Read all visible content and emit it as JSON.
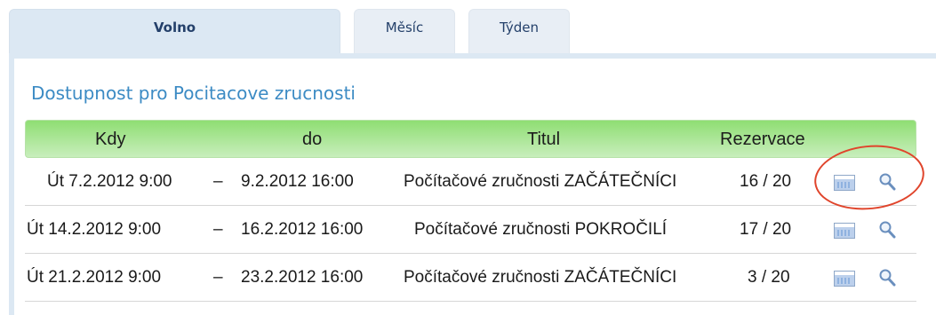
{
  "tabs": [
    {
      "label": "Volno",
      "active": true
    },
    {
      "label": "Měsíc",
      "active": false
    },
    {
      "label": "Týden",
      "active": false
    }
  ],
  "availability_title": "Dostupnost pro Pocitacove zrucnosti",
  "table": {
    "headers": {
      "when": "Kdy",
      "to": "do",
      "title": "Titul",
      "reservations": "Rezervace"
    },
    "rows": [
      {
        "from": "Út 7.2.2012 9:00",
        "dash": "–",
        "to": "9.2.2012 16:00",
        "title": "Počítačové zručnosti ZAČÁTEČNÍCI",
        "reservations": "16 / 20"
      },
      {
        "from": "Út 14.2.2012 9:00",
        "dash": "–",
        "to": "16.2.2012 16:00",
        "title": "Počítačové zručnosti POKROČILÍ",
        "reservations": "17 / 20"
      },
      {
        "from": "Út 21.2.2012 9:00",
        "dash": "–",
        "to": "23.2.2012 16:00",
        "title": "Počítačové zručnosti ZAČÁTEČNÍCI",
        "reservations": "3 / 20"
      }
    ]
  },
  "icons": {
    "calendar": "calendar-icon",
    "details": "magnifier-icon"
  },
  "colors": {
    "header_green": "#8fde73",
    "title_blue": "#3c8bc4",
    "tab_bg": "#dce8f3",
    "highlight": "#e0452c"
  }
}
